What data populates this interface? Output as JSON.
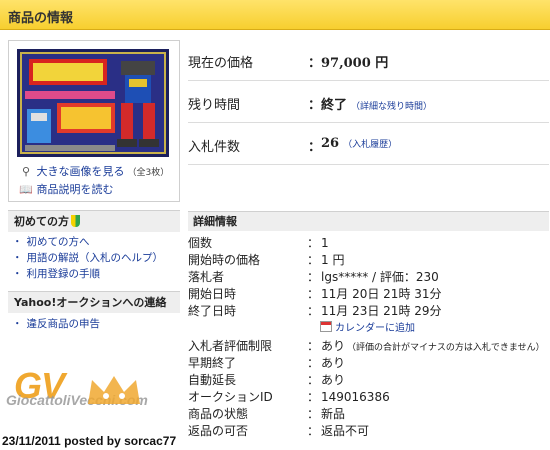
{
  "header": {
    "title": "商品の情報"
  },
  "image_panel": {
    "link_large": "大きな画像を見る",
    "count": "（全3枚）",
    "link_desc": "商品説明を読む"
  },
  "price": {
    "current_label": "現在の価格",
    "current_value": "97,000 円",
    "remaining_label": "残り時間",
    "remaining_value": "終了",
    "remaining_link": "（詳細な残り時間）",
    "bids_label": "入札件数",
    "bids_value": "26",
    "bids_link": "（入札履歴）",
    "colon": "："
  },
  "sidebar": {
    "beginner_title": "初めての方",
    "beginner_links": [
      "初めての方へ",
      "用語の解説（入札のヘルプ）",
      "利用登録の手順"
    ],
    "contact_title": "Yahoo!オークションへの連絡",
    "contact_links": [
      "違反商品の申告"
    ]
  },
  "details": {
    "title": "詳細情報",
    "rows": [
      {
        "label": "個数",
        "value": "1"
      },
      {
        "label": "開始時の価格",
        "value": "1 円"
      },
      {
        "label": "落札者",
        "value": "lgs***** / 評価：230"
      },
      {
        "label": "開始日時",
        "value": "11月 20日 21時 31分"
      },
      {
        "label": "終了日時",
        "value": "11月 23日 21時 29分"
      },
      {
        "label": "入札者評価制限",
        "value": "あり",
        "note": "（評価の合計がマイナスの方は入札できません）"
      },
      {
        "label": "早期終了",
        "value": "あり"
      },
      {
        "label": "自動延長",
        "value": "あり"
      },
      {
        "label": "オークションID",
        "value": "149016386"
      },
      {
        "label": "商品の状態",
        "value": "新品"
      },
      {
        "label": "返品の可否",
        "value": "返品不可"
      }
    ],
    "calendar_link": "カレンダーに追加"
  },
  "watermark": {
    "logo": "GV",
    "site": "GiocattoliVecchi.com",
    "posted": "23/11/2011 posted by sorcac77"
  },
  "colors": {
    "header_yellow": "#f7cf2f",
    "link_blue": "#1a3c99",
    "section_gray": "#eeeeee",
    "watermark_orange": "#f0a830"
  }
}
